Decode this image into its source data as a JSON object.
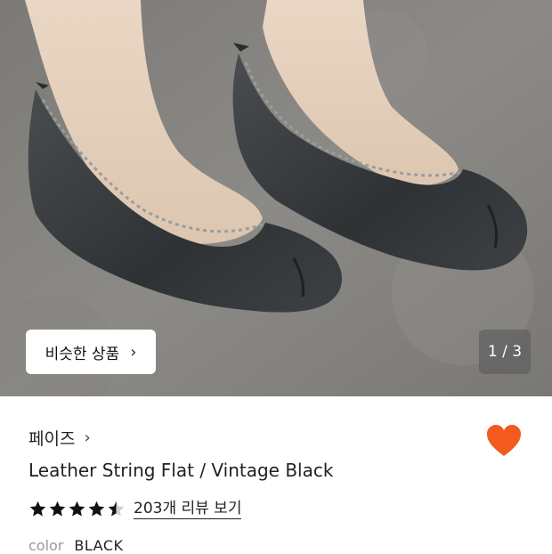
{
  "product_image": {
    "similar_button_label": "비슷한 상품",
    "counter": "1 / 3",
    "icons": [
      "chevron-right-icon"
    ]
  },
  "product": {
    "brand": "페이즈",
    "title": "Leather String Flat / Vintage Black",
    "rating": 4.5,
    "review_link": "203개 리뷰 보기",
    "option_label": "color",
    "option_value": "BLACK"
  },
  "colors": {
    "heart": "#F25A1E",
    "star": "#111111",
    "counter_bg": "#5F5F5F"
  },
  "icons": {
    "favorite": "heart-icon",
    "brand_link": "chevron-right-icon",
    "rating": "star-icon"
  }
}
